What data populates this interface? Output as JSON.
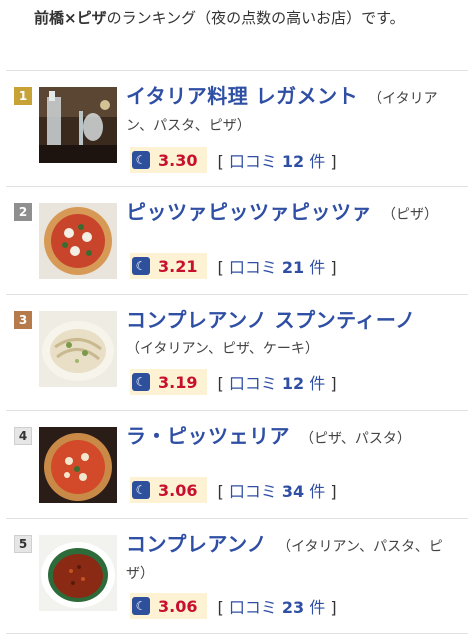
{
  "intro": {
    "bold": "前橋×ピザ",
    "rest": "のランキング（夜の点数の高いお店）です。"
  },
  "colors": {
    "link": "#2f4fa4",
    "score": "#c8102e",
    "score_bg": "#fdf3d4",
    "moon_bg": "#2e4f9c"
  },
  "icons": {
    "rating_time": "moon-icon"
  },
  "restaurants": [
    {
      "rank": "1",
      "medal": "gold",
      "name": "イタリア料理 レガメント",
      "genre": "（イタリアン、パスタ、ピザ）",
      "score": "3.30",
      "reviews_label": "口コミ",
      "reviews_count": "12",
      "reviews_unit": "件"
    },
    {
      "rank": "2",
      "medal": "silver",
      "name": "ピッツァピッツァピッツァ",
      "genre": "（ピザ）",
      "score": "3.21",
      "reviews_label": "口コミ",
      "reviews_count": "21",
      "reviews_unit": "件"
    },
    {
      "rank": "3",
      "medal": "bronze",
      "name": "コンプレアンノ スプンティーノ",
      "genre": "（イタリアン、ピザ、ケーキ）",
      "score": "3.19",
      "reviews_label": "口コミ",
      "reviews_count": "12",
      "reviews_unit": "件"
    },
    {
      "rank": "4",
      "medal": "plain",
      "name": "ラ・ピッツェリア",
      "genre": "（ピザ、パスタ）",
      "score": "3.06",
      "reviews_label": "口コミ",
      "reviews_count": "34",
      "reviews_unit": "件"
    },
    {
      "rank": "5",
      "medal": "plain",
      "name": "コンプレアンノ",
      "genre": "（イタリアン、パスタ、ピザ）",
      "score": "3.06",
      "reviews_label": "口コミ",
      "reviews_count": "23",
      "reviews_unit": "件"
    }
  ]
}
